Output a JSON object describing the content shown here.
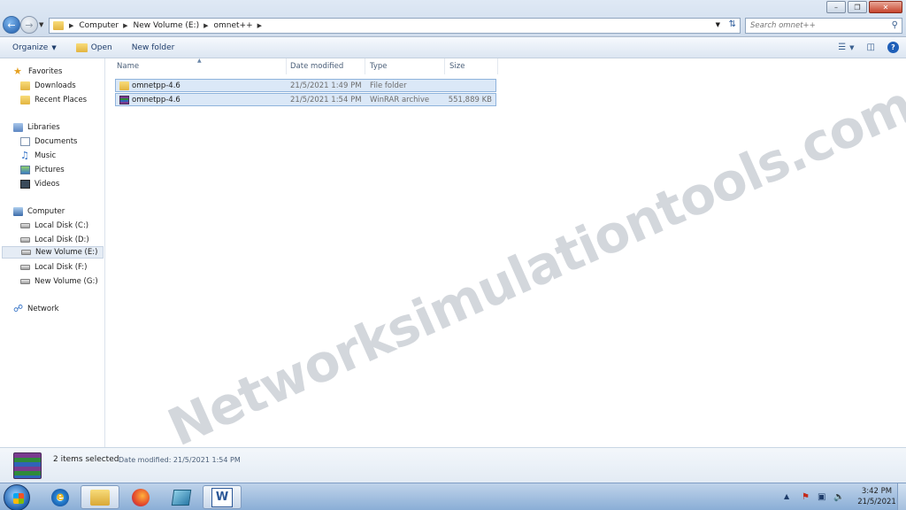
{
  "address_bar": {
    "crumbs": [
      "Computer",
      "New Volume (E:)",
      "omnet++"
    ]
  },
  "search": {
    "placeholder": "Search omnet++"
  },
  "toolbar": {
    "organize": "Organize",
    "open": "Open",
    "new_folder": "New folder"
  },
  "sidebar": {
    "favorites": "Favorites",
    "downloads": "Downloads",
    "recent_places": "Recent Places",
    "libraries": "Libraries",
    "documents": "Documents",
    "music": "Music",
    "pictures": "Pictures",
    "videos": "Videos",
    "computer": "Computer",
    "local_disk_c": "Local Disk (C:)",
    "local_disk_d": "Local Disk (D:)",
    "new_volume_e": "New Volume (E:)",
    "local_disk_f": "Local Disk (F:)",
    "new_volume_g": "New Volume (G:)",
    "network": "Network"
  },
  "columns": {
    "name": "Name",
    "date_modified": "Date modified",
    "type": "Type",
    "size": "Size"
  },
  "files": [
    {
      "name": "omnetpp-4.6",
      "date": "21/5/2021 1:49 PM",
      "type": "File folder",
      "size": ""
    },
    {
      "name": "omnetpp-4.6",
      "date": "21/5/2021 1:54 PM",
      "type": "WinRAR archive",
      "size": "551,889 KB"
    }
  ],
  "watermark": "Networksimulationtools.com",
  "details": {
    "count": "2 items selected",
    "date": "Date modified: 21/5/2021 1:54 PM"
  },
  "clock": {
    "time": "3:42 PM",
    "date": "21/5/2021"
  },
  "taskbar": {
    "word_letter": "W",
    "ie_letter": "e"
  }
}
